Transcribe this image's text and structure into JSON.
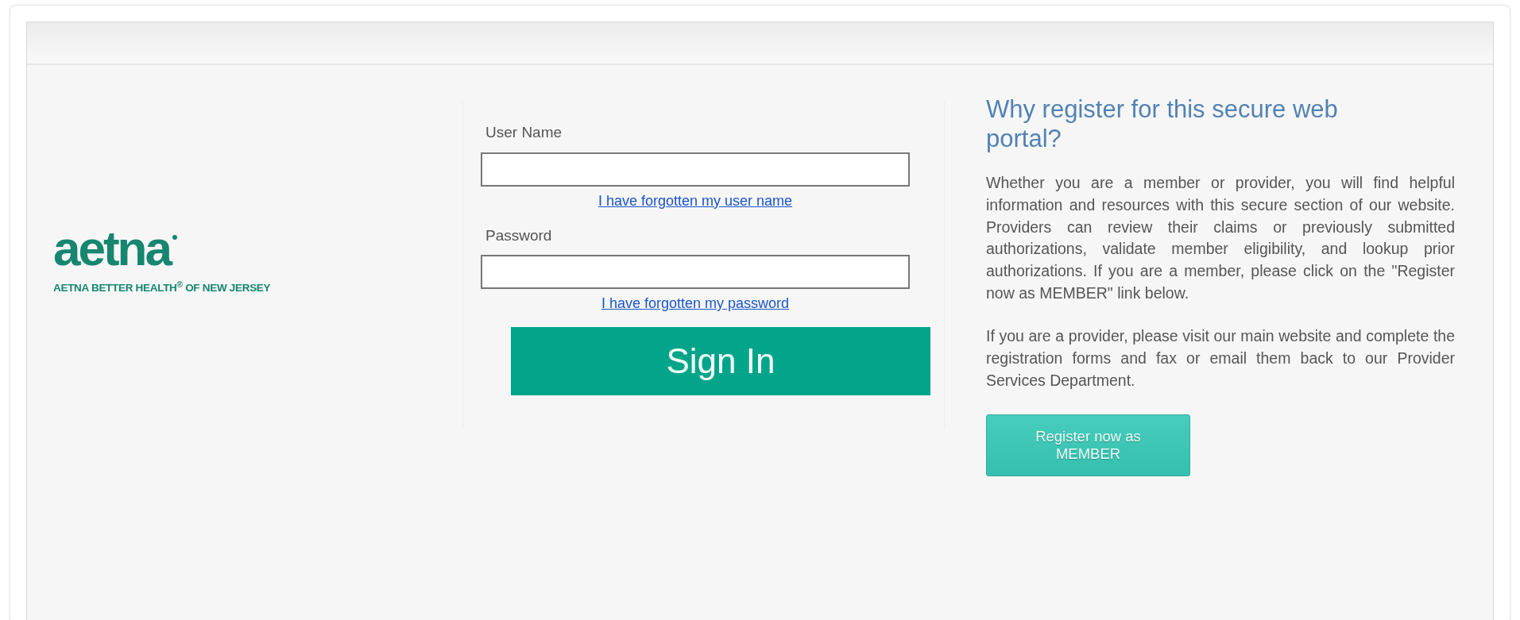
{
  "logo": {
    "wordmark": "aetna",
    "tagline": "AETNA BETTER HEALTH$^{®}$ OF NEW JERSEY"
  },
  "login": {
    "fields": [
      {
        "label": "User Name",
        "link": "I have forgotten my user name"
      },
      {
        "label": "Password",
        "link": "I have forgotten my password"
      }
    ],
    "submit": "Sign In"
  },
  "info": {
    "heading": "Why register for this secure web portal?",
    "paragraphs": [
      "Whether you are a member or provider, you will find helpful information and resources with this secure section of our website. Providers can review their claims or previously submitted authorizations, validate member eligibility, and lookup prior authorizations. If you are a member, please click on the \"Register now as MEMBER\" link below.",
      "If you are a provider, please visit our main website and complete the registration forms and fax or email them back to our Provider Services Department."
    ],
    "register_button": "Register now as MEMBER"
  }
}
